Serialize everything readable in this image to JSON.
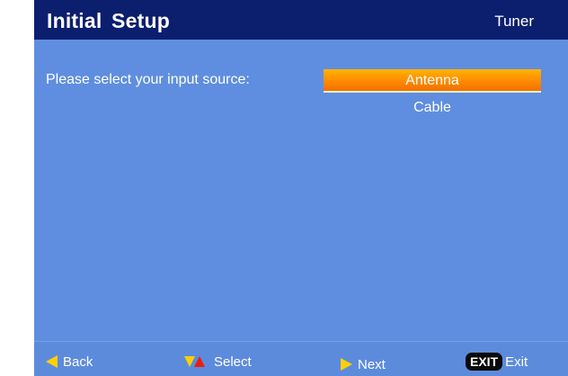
{
  "header": {
    "title": "Initial  Setup",
    "tab": "Tuner"
  },
  "main": {
    "prompt": "Please select your input source:",
    "options": [
      {
        "label": "Antenna",
        "selected": true
      },
      {
        "label": "Cable",
        "selected": false
      }
    ]
  },
  "footer": {
    "back": {
      "icon": "left-arrow-icon",
      "label": "Back"
    },
    "select": {
      "icon": "up-down-arrows-icon",
      "label": "Select"
    },
    "next": {
      "icon": "right-arrow-icon",
      "label": "Next"
    },
    "exit": {
      "key": "EXIT",
      "label": "Exit"
    }
  },
  "colors": {
    "header_bg": "#0c1e6e",
    "panel_bg": "#5f8ee0",
    "highlight": "#ff8a00",
    "arrow_yellow": "#ffd000",
    "arrow_red": "#e8200c"
  }
}
